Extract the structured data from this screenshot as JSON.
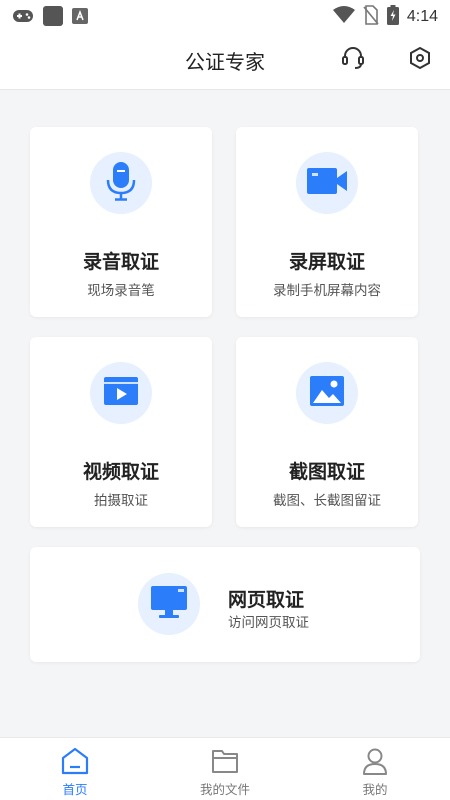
{
  "status_bar": {
    "time": "4:14",
    "icons": [
      "gamepad-icon",
      "square-app-icon",
      "text-a-icon",
      "wifi-icon",
      "no-sim-icon",
      "battery-charging-icon"
    ]
  },
  "header": {
    "title": "公证专家",
    "right_icons": [
      "headset-icon",
      "hexagon-settings-icon"
    ]
  },
  "cards": [
    {
      "title": "录音取证",
      "subtitle": "现场录音笔",
      "icon": "microphone-icon"
    },
    {
      "title": "录屏取证",
      "subtitle": "录制手机屏幕内容",
      "icon": "video-camera-icon"
    },
    {
      "title": "视频取证",
      "subtitle": "拍摄取证",
      "icon": "video-play-icon"
    },
    {
      "title": "截图取证",
      "subtitle": "截图、长截图留证",
      "icon": "image-icon"
    },
    {
      "title": "网页取证",
      "subtitle": "访问网页取证",
      "icon": "monitor-icon"
    }
  ],
  "bottom_nav": [
    {
      "label": "首页",
      "icon": "home-icon",
      "active": true
    },
    {
      "label": "我的文件",
      "icon": "folder-icon",
      "active": false
    },
    {
      "label": "我的",
      "icon": "user-icon",
      "active": false
    }
  ],
  "colors": {
    "accent": "#2b7dfa",
    "icon_bg": "#e6f0ff",
    "background": "#f4f5f7",
    "card": "#ffffff"
  }
}
